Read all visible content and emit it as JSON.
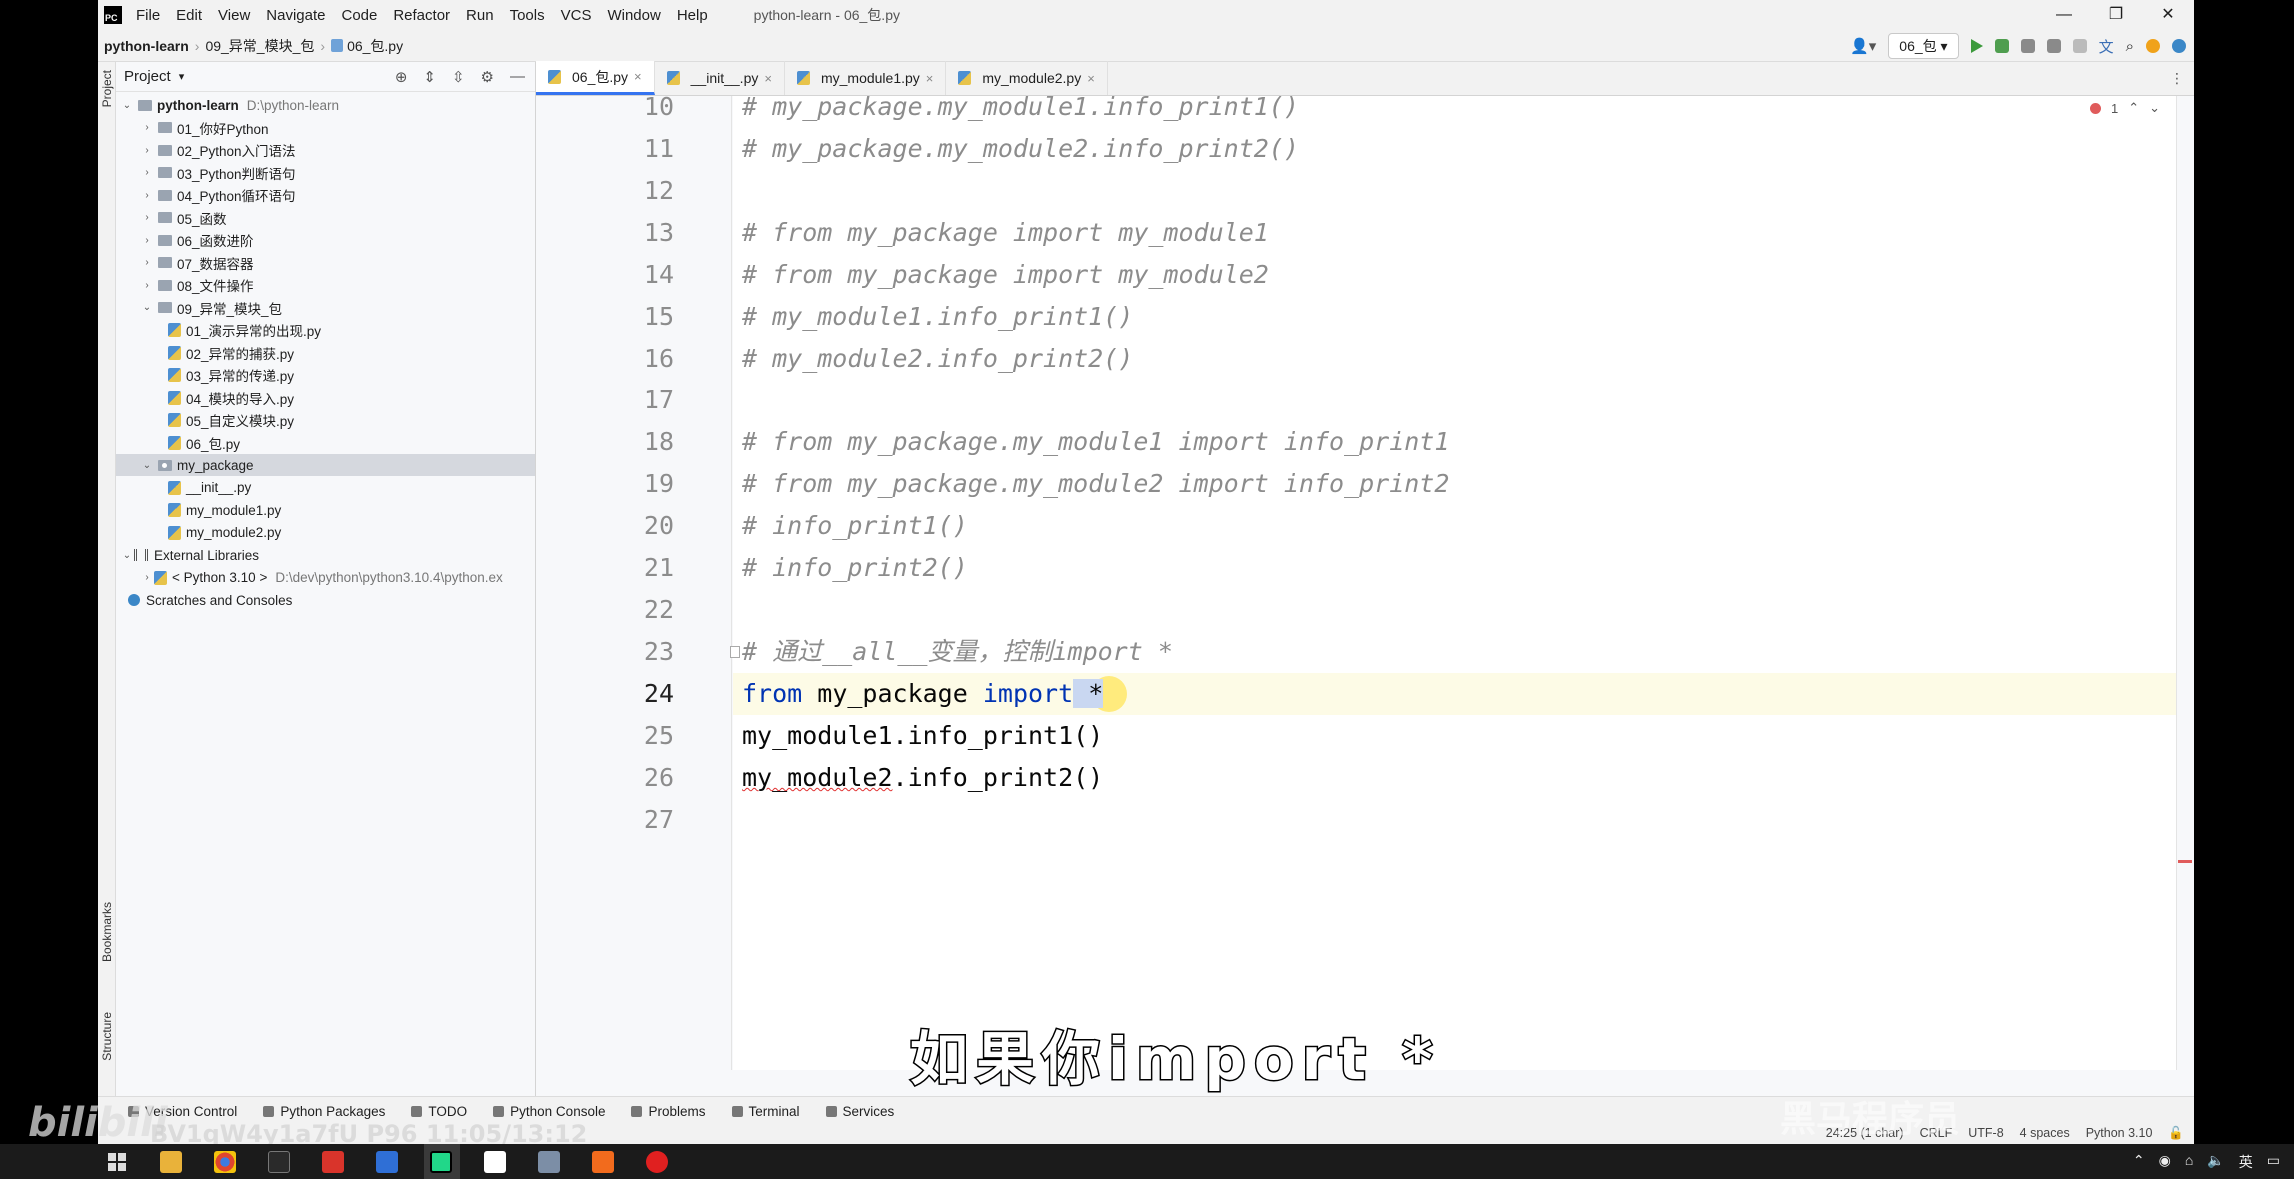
{
  "app": {
    "logo_text": "PC",
    "menu": [
      "File",
      "Edit",
      "View",
      "Navigate",
      "Code",
      "Refactor",
      "Run",
      "Tools",
      "VCS",
      "Window",
      "Help"
    ],
    "window_title": "python-learn - 06_包.py",
    "window_buttons": [
      "—",
      "❐",
      "✕"
    ]
  },
  "breadcrumb": [
    "python-learn",
    "09_异常_模块_包",
    "06_包.py"
  ],
  "run_config": "06_包",
  "project_panel": {
    "title": "Project",
    "tree": [
      {
        "label": "python-learn",
        "extra": "D:\\python-learn",
        "type": "root"
      },
      {
        "label": "01_你好Python",
        "type": "folder"
      },
      {
        "label": "02_Python入门语法",
        "type": "folder"
      },
      {
        "label": "03_Python判断语句",
        "type": "folder"
      },
      {
        "label": "04_Python循环语句",
        "type": "folder"
      },
      {
        "label": "05_函数",
        "type": "folder"
      },
      {
        "label": "06_函数进阶",
        "type": "folder"
      },
      {
        "label": "07_数据容器",
        "type": "folder"
      },
      {
        "label": "08_文件操作",
        "type": "folder"
      },
      {
        "label": "09_异常_模块_包",
        "type": "folder-open"
      },
      {
        "label": "01_演示异常的出现.py",
        "type": "file"
      },
      {
        "label": "02_异常的捕获.py",
        "type": "file"
      },
      {
        "label": "03_异常的传递.py",
        "type": "file"
      },
      {
        "label": "04_模块的导入.py",
        "type": "file"
      },
      {
        "label": "05_自定义模块.py",
        "type": "file"
      },
      {
        "label": "06_包.py",
        "type": "file"
      },
      {
        "label": "my_package",
        "type": "package"
      },
      {
        "label": "__init__.py",
        "type": "file"
      },
      {
        "label": "my_module1.py",
        "type": "file"
      },
      {
        "label": "my_module2.py",
        "type": "file"
      },
      {
        "label": "External Libraries",
        "type": "lib"
      },
      {
        "label": "< Python 3.10 >",
        "extra": "D:\\dev\\python\\python3.10.4\\python.ex",
        "type": "sdk"
      },
      {
        "label": "Scratches and Consoles",
        "type": "scratch"
      }
    ]
  },
  "tabs": [
    {
      "label": "06_包.py",
      "active": true
    },
    {
      "label": "__init__.py",
      "active": false
    },
    {
      "label": "my_module1.py",
      "active": false
    },
    {
      "label": "my_module2.py",
      "active": false
    }
  ],
  "inspection": {
    "errors": "1"
  },
  "editor": {
    "lines": [
      {
        "n": "10",
        "text": "# my_package.my_module1.info_print1()"
      },
      {
        "n": "11",
        "text": "# my_package.my_module2.info_print2()"
      },
      {
        "n": "12",
        "text": ""
      },
      {
        "n": "13",
        "text": "# from my_package import my_module1"
      },
      {
        "n": "14",
        "text": "# from my_package import my_module2"
      },
      {
        "n": "15",
        "text": "# my_module1.info_print1()"
      },
      {
        "n": "16",
        "text": "# my_module2.info_print2()"
      },
      {
        "n": "17",
        "text": ""
      },
      {
        "n": "18",
        "text": "# from my_package.my_module1 import info_print1"
      },
      {
        "n": "19",
        "text": "# from my_package.my_module2 import info_print2"
      },
      {
        "n": "20",
        "text": "# info_print1()"
      },
      {
        "n": "21",
        "text": "# info_print2()"
      },
      {
        "n": "22",
        "text": ""
      },
      {
        "n": "23",
        "text": "# 通过__all__变量，控制import *"
      },
      {
        "n": "24",
        "kw1": "from",
        "mid": " my_package ",
        "kw2": "import",
        "tail": " *"
      },
      {
        "n": "25",
        "text": "my_module1.info_print1()"
      },
      {
        "n": "26",
        "err": "my_module2",
        "text": ".info_print2()"
      },
      {
        "n": "27",
        "text": ""
      }
    ]
  },
  "subtitle": "如果你import *",
  "tool_windows": [
    "Version Control",
    "Python Packages",
    "TODO",
    "Python Console",
    "Problems",
    "Terminal",
    "Services"
  ],
  "status": {
    "position": "24:25 (1 char)",
    "line_sep": "CRLF",
    "encoding": "UTF-8",
    "indent": "4 spaces",
    "interpreter": "Python 3.10"
  },
  "watermarks": {
    "site": "bilibili",
    "video": "BV1qW4y1a7fU P96 11:05/13:12",
    "brand": "黑马程序员"
  },
  "tray": {
    "ime": "英"
  }
}
